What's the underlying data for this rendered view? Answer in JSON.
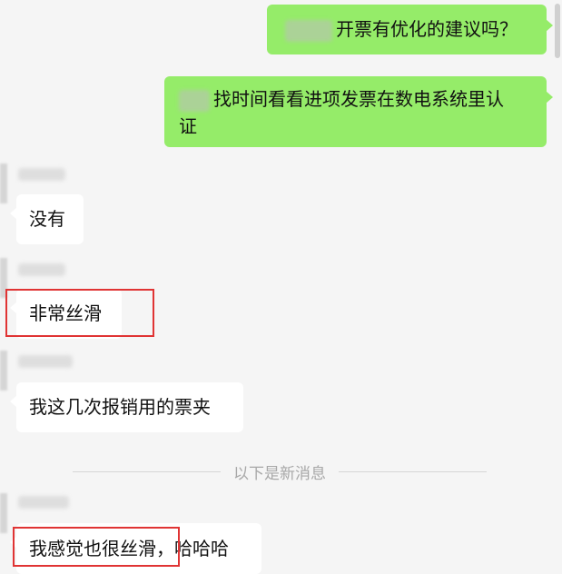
{
  "messages": [
    {
      "direction": "out",
      "text": "开票有优化的建议吗？"
    },
    {
      "direction": "out",
      "text_line1": "找时间看看进项发票在数电系统里认",
      "text_line2": "证"
    },
    {
      "direction": "in",
      "text": "没有"
    },
    {
      "direction": "in",
      "text": "非常丝滑"
    },
    {
      "direction": "in",
      "text": "我这几次报销用的票夹"
    },
    {
      "direction": "in",
      "text_part1": "我感觉也很丝滑，",
      "text_part2": "哈哈哈"
    }
  ],
  "divider": {
    "label": "以下是新消息"
  },
  "colors": {
    "background": "#f5f5f5",
    "outgoing_bubble": "#95ec69",
    "incoming_bubble": "#ffffff",
    "highlight_border": "#e03434",
    "divider_text": "#a8a8a8"
  }
}
